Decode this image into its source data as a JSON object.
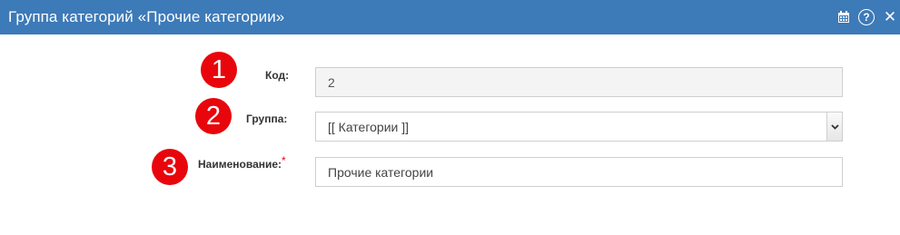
{
  "window": {
    "title": "Группа категорий «Прочие категории»"
  },
  "toolbar": {
    "icons": [
      "calendar-icon",
      "help-icon",
      "close-icon"
    ],
    "help_glyph": "?",
    "close_glyph": "✕"
  },
  "colors": {
    "titlebar": "#3d7ab8",
    "badge": "#e8060c",
    "required": "#e8060c"
  },
  "form": {
    "code": {
      "badge": "1",
      "label": "Код:",
      "value": "2"
    },
    "group": {
      "badge": "2",
      "label": "Группа:",
      "value": "[[ Категории ]]"
    },
    "name": {
      "badge": "3",
      "label": "Наименование:",
      "required_mark": "*",
      "value": "Прочие категории"
    }
  }
}
